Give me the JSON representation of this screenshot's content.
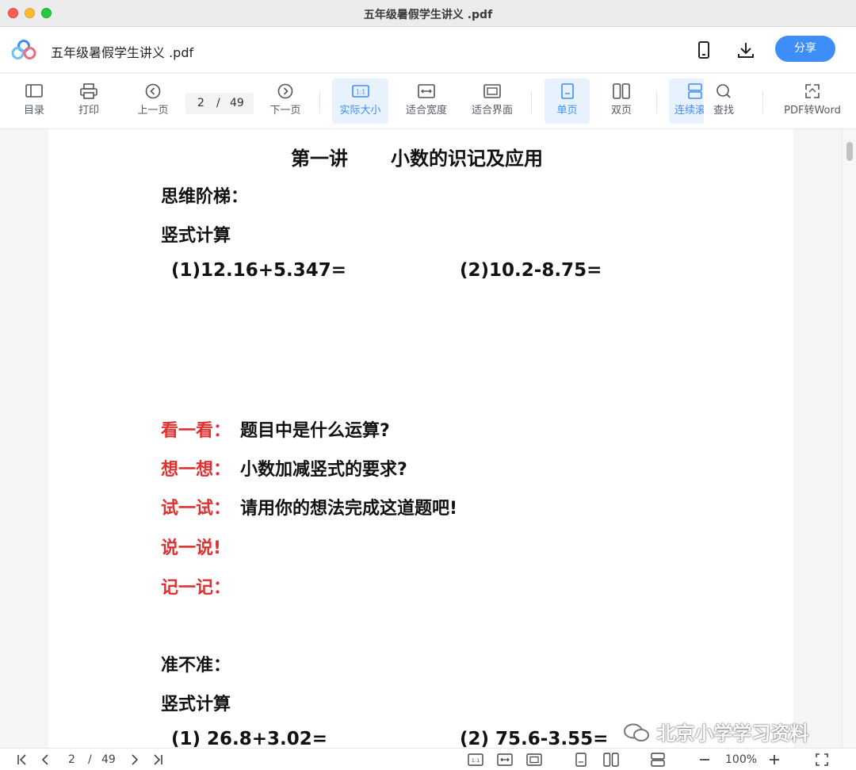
{
  "window": {
    "title": "五年级暑假学生讲义 .pdf"
  },
  "header": {
    "doc_title": "五年级暑假学生讲义 .pdf",
    "share_label": "分享"
  },
  "toolbar": {
    "toc": "目录",
    "print": "打印",
    "prev": "上一页",
    "page_current": "2",
    "page_sep": "/",
    "page_total": "49",
    "next": "下一页",
    "actual_size": "实际大小",
    "fit_width": "适合宽度",
    "fit_page": "适合界面",
    "single": "单页",
    "double": "双页",
    "continuous": "连续滚",
    "find": "查找",
    "pdf_to_word": "PDF转Word"
  },
  "content": {
    "title_a": "第一讲",
    "title_b": "小数的识记及应用",
    "section1": "思维阶梯：",
    "sub1": "竖式计算",
    "eq1": "(1)12.16+5.347=",
    "eq2": "(2)10.2-8.75=",
    "look_label": "看一看：",
    "look_text": "题目中是什么运算?",
    "think_label": "想一想：",
    "think_text": "小数加减竖式的要求?",
    "try_label": "试一试：",
    "try_text": "请用你的想法完成这道题吧!",
    "say_label": "说一说!",
    "note_label": "记一记：",
    "section2": "准不准：",
    "sub2": "竖式计算",
    "eq3": "(1) 26.8+3.02=",
    "eq4": "(2) 75.6-3.55="
  },
  "bottom": {
    "page_current": "2",
    "page_sep": "/",
    "page_total": "49",
    "zoom": "100%"
  },
  "watermark": "北京小学学习资料",
  "colors": {
    "accent": "#3d8ef8",
    "red": "#e03131"
  }
}
